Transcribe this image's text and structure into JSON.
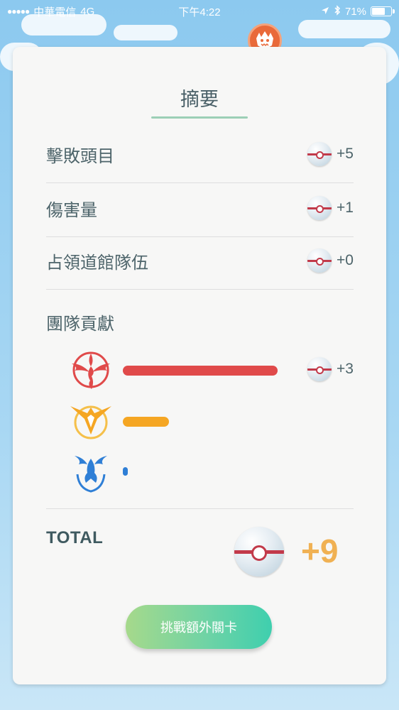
{
  "status_bar": {
    "signal": "●●●●●",
    "carrier": "中華電信",
    "network": "4G",
    "time": "下午4:22",
    "battery_text": "71%",
    "battery_level": 0.71
  },
  "summary": {
    "title": "摘要",
    "rows": [
      {
        "label": "擊敗頭目",
        "reward": "+5"
      },
      {
        "label": "傷害量",
        "reward": "+1"
      },
      {
        "label": "占領道館隊伍",
        "reward": "+0"
      }
    ],
    "team_section_label": "團隊貢獻",
    "teams": [
      {
        "name": "valor",
        "icon": "valor-team-icon",
        "color": "#e04a4a",
        "contribution": 1.0,
        "reward": "+3"
      },
      {
        "name": "instinct",
        "icon": "instinct-team-icon",
        "color": "#f5a623",
        "contribution": 0.3,
        "reward": ""
      },
      {
        "name": "mystic",
        "icon": "mystic-team-icon",
        "color": "#2f7fd6",
        "contribution": 0.03,
        "reward": ""
      }
    ],
    "total_label": "TOTAL",
    "total_value": "+9",
    "button_label": "挑戰額外關卡"
  },
  "colors": {
    "accent_green": "#9ccfb6",
    "total_gold": "#f0b153",
    "boss_badge": "#e96a3a"
  }
}
